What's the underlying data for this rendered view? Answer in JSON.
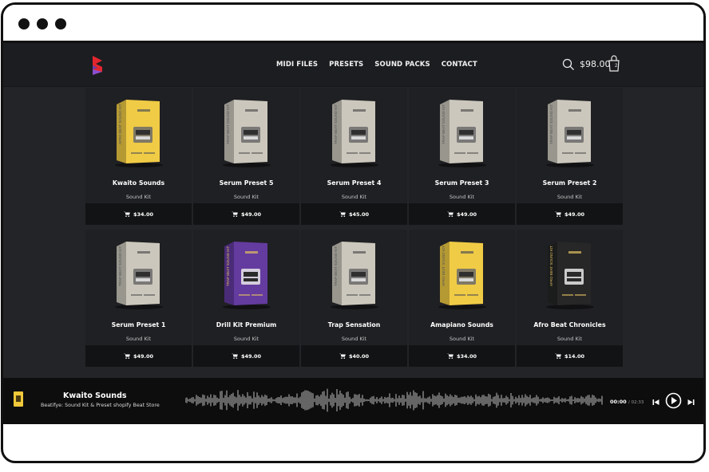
{
  "nav": {
    "links": [
      "MIDI FILES",
      "PRESETS",
      "SOUND PACKS",
      "CONTACT"
    ]
  },
  "header": {
    "cart_total": "$98.00",
    "cart_count": "2",
    "icons": [
      "logo-icon",
      "search-icon",
      "shopping-bag-icon"
    ]
  },
  "products": [
    {
      "title": "Kwaito Sounds",
      "subtitle": "Sound Kit",
      "price": "$34.00",
      "box_color": "#f0c83a",
      "spine_text": "AFRO BEAT SOUND KIT"
    },
    {
      "title": "Serum Preset 5",
      "subtitle": "Sound Kit",
      "price": "$49.00",
      "box_color": "#c9c4b8",
      "spine_text": "TRAP BEAT SOUND KIT"
    },
    {
      "title": "Serum Preset 4",
      "subtitle": "Sound Kit",
      "price": "$45.00",
      "box_color": "#c9c4b8",
      "spine_text": "TRAP BEAT SOUND KIT"
    },
    {
      "title": "Serum Preset 3",
      "subtitle": "Sound Kit",
      "price": "$49.00",
      "box_color": "#c9c4b8",
      "spine_text": "TRAP BEAT SOUND KIT"
    },
    {
      "title": "Serum Preset 2",
      "subtitle": "Sound Kit",
      "price": "$49.00",
      "box_color": "#c9c4b8",
      "spine_text": "TRAP BEAT SOUND KIT"
    },
    {
      "title": "Serum Preset 1",
      "subtitle": "Sound Kit",
      "price": "$49.00",
      "box_color": "#c9c4b8",
      "spine_text": "TRAP BEAT SOUND KIT"
    },
    {
      "title": "Drill Kit Premium",
      "subtitle": "Sound Kit",
      "price": "$49.00",
      "box_color": "#5b2f9a",
      "spine_text": "TRAP BEAT SOUND KIT"
    },
    {
      "title": "Trap Sensation",
      "subtitle": "Sound Kit",
      "price": "$40.00",
      "box_color": "#c9c4b8",
      "spine_text": "TRAP BEAT SOUND KIT"
    },
    {
      "title": "Amapiano Sounds",
      "subtitle": "Sound Kit",
      "price": "$34.00",
      "box_color": "#f0c83a",
      "spine_text": "AFRO BEAT SOUND KIT"
    },
    {
      "title": "Afro Beat Chronicles",
      "subtitle": "Sound Kit",
      "price": "$14.00",
      "box_color": "#1a1a1a",
      "spine_text": "AFRO BEAT SOUND KIT"
    }
  ],
  "player": {
    "title": "Kwaito Sounds",
    "subtitle": "Beatifye: Sound Kit & Preset shopify Beat Store",
    "current_time": "00:00",
    "total_time": "/ 02:33",
    "thumb_color": "#f0c83a",
    "icons": [
      "previous-track-icon",
      "play-icon",
      "next-track-icon"
    ]
  },
  "colors": {
    "page_bg": "#232427",
    "card_bg": "#1f2023",
    "buy_bar_bg": "#121314",
    "player_bg": "#0d0d0e",
    "logo_red": "#e3262e",
    "logo_purple": "#6a3fb0"
  }
}
